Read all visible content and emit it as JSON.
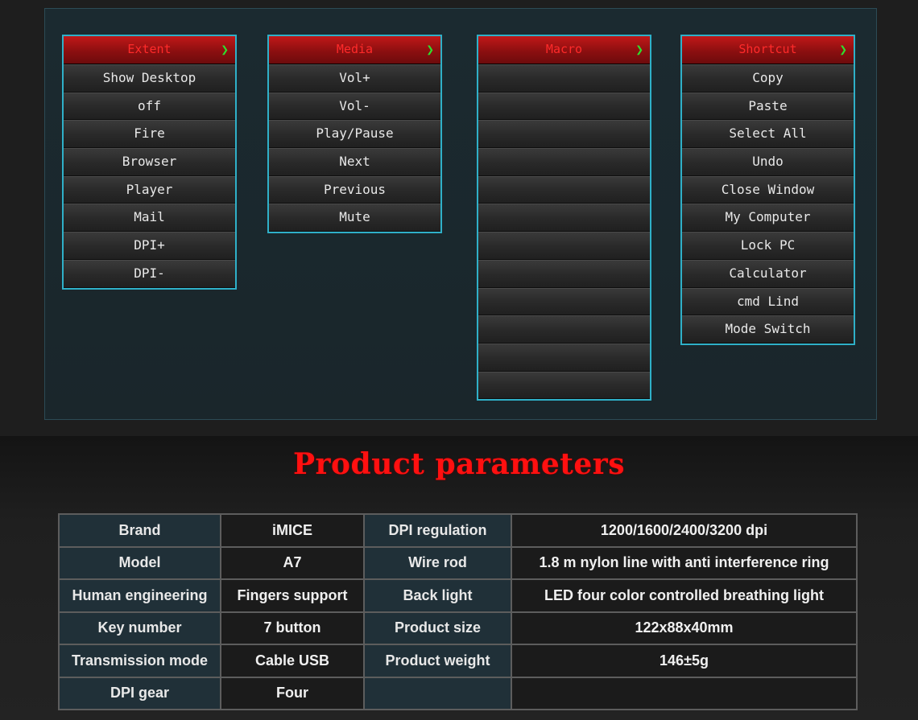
{
  "menus": [
    {
      "title": "Extent",
      "items": [
        "Show Desktop",
        "off",
        "Fire",
        "Browser",
        "Player",
        "Mail",
        "DPI+",
        "DPI-"
      ]
    },
    {
      "title": "Media",
      "items": [
        "Vol+",
        "Vol-",
        "Play/Pause",
        "Next",
        "Previous",
        "Mute"
      ]
    },
    {
      "title": "Macro",
      "items": [
        "",
        "",
        "",
        "",
        "",
        "",
        "",
        "",
        "",
        "",
        "",
        ""
      ]
    },
    {
      "title": "Shortcut",
      "items": [
        "Copy",
        "Paste",
        "Select All",
        "Undo",
        "Close Window",
        "My Computer",
        "Lock PC",
        "Calculator",
        "cmd Lind",
        "Mode Switch"
      ]
    }
  ],
  "arrow_icon": "chevron-right-icon",
  "colors": {
    "header_red": "#c01818",
    "header_text": "#ff2a2a",
    "arrow_green": "#2ee02e",
    "menu_border": "#2fb0c8",
    "title_red": "#ff1010"
  },
  "params": {
    "title": "Product parameters",
    "rows": [
      [
        "Brand",
        "iMICE",
        "DPI regulation",
        "1200/1600/2400/3200 dpi"
      ],
      [
        "Model",
        "A7",
        "Wire rod",
        "1.8 m nylon line with anti interference ring"
      ],
      [
        "Human engineering",
        "Fingers support",
        "Back light",
        "LED four color controlled breathing light"
      ],
      [
        "Key number",
        "7 button",
        "Product size",
        "122x88x40mm"
      ],
      [
        "Transmission mode",
        "Cable USB",
        "Product weight",
        "146±5g"
      ],
      [
        "DPI gear",
        "Four",
        "",
        ""
      ]
    ]
  }
}
